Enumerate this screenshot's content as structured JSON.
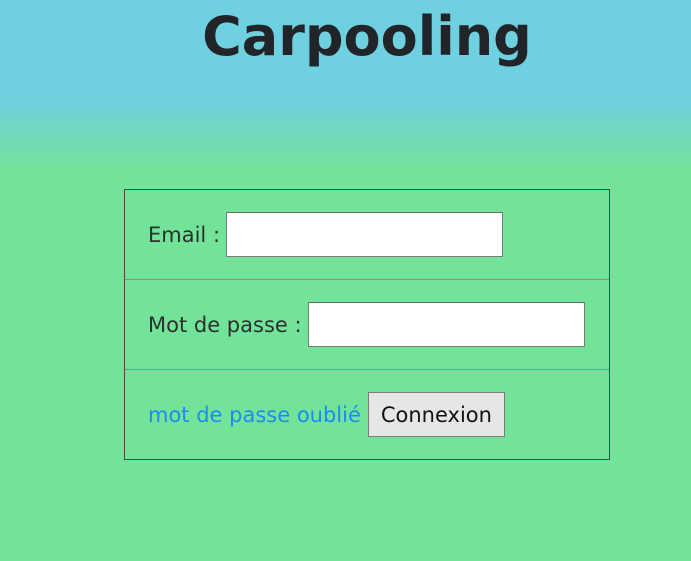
{
  "header": {
    "title": "Carpooling"
  },
  "login_form": {
    "email_label": "Email :",
    "email_value": "",
    "password_label": "Mot de passe :",
    "password_value": "",
    "forgot_link": "mot de passe oublié",
    "submit_label": "Connexion"
  },
  "colors": {
    "sky": "#6fd0e0",
    "grass": "#74e39a",
    "link": "#1a8cf0",
    "button": "#e6e6e6"
  }
}
